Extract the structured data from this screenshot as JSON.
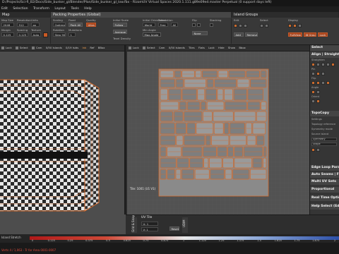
{
  "window": {
    "title": "D:/Projects/Sci-fi_B2/Docs/Side_bunker_gl/Blender/Plan/Side_bunker_gl_low.fbx - RizomUV Virtual Spaces 2020.1.111.g89e09ed.master Perpetual (0 support days left)"
  },
  "menu": [
    "Edit",
    "Selection",
    "Transform",
    "Layout",
    "Tools",
    "Help"
  ],
  "toolbar": {
    "map_head": "Map",
    "packing_head": "Packing Properties (Global)",
    "island_head": "Island Groups",
    "map": {
      "size_label": "Map Size",
      "size_value": "2048",
      "res_label": "Resolution",
      "res_value": "512",
      "margin_label": "Margin",
      "margin_value": "0.125",
      "space_label": "Spacing",
      "space_value": "0.125",
      "unit_label": "Units",
      "unit_value": "px",
      "tex_label": "Texture",
      "tex_value": "Auto"
    },
    "packing": {
      "scaling_label": "Scaling",
      "scaling_value": "Optimize",
      "fixed_label": "Fixed",
      "fixed_value": "Pack All",
      "rotation_label": "Rotation",
      "rotation_value": "Step 90",
      "mutations_label": "Mutations",
      "mutations_value": "1",
      "quality_label": "Quality",
      "quality_value": "Ultra",
      "follow_label": "Initial Scale",
      "follow_value": "Follow",
      "average_label": "Average",
      "texel_label": "Texel Density",
      "init_label": "Initial Orientation",
      "init_value": "World",
      "translation_label": "Translation",
      "translation_value": "Free",
      "min_angle_label": "Min Angle",
      "max_angle_label": "Max Angle",
      "optimize_label": "Optimize on",
      "optimize_value": "All",
      "flip_label": "Flip",
      "flip_value": "None",
      "stack_label": "Stacking"
    },
    "island": {
      "edit_label": "Edit",
      "select_label": "Select",
      "display_label": "Display",
      "add_label": "Add",
      "remove_label": "Remove",
      "fullview": "FullView",
      "ib": "IB Grou",
      "lock": "Lock"
    }
  },
  "viewport3d": {
    "tools": [
      "Lock",
      "Select",
      "Cam",
      "0/50 Islands",
      "0/19 Islds",
      "Ink",
      "Ref",
      "BBox",
      "1/1"
    ]
  },
  "viewport_uv": {
    "tools": [
      "Lock",
      "Select",
      "Cam",
      "0/50 Islands",
      "0/19 Islds",
      "Tiles",
      "Flats",
      "Lock",
      "Hide",
      "Show",
      "Bbox"
    ],
    "tile_info": "Tile: 1001 (U1 V1)"
  },
  "right_panel": {
    "select_head": "Select",
    "align_head": "Align | Straighten",
    "straighten_label": "Straighten",
    "pin_label": "Pin",
    "flip_label": "Flip",
    "angle_label": "Angle",
    "orient_label": "Orient",
    "topocopy_head": "TopoCopy",
    "settings_label": "Settings",
    "topo_ref": "Topology reference",
    "symmetry": "Symmetry mode",
    "source_label": "Source island",
    "sym_value": "Symmetry",
    "sym_value2": "Shape",
    "edge_loop": "Edge Loop Parameters",
    "auto_seams": "Auto Seams | Fun",
    "multi_uv": "Multi UV Sets",
    "proportional": "Proportional",
    "real_time": "Real Time Options",
    "help_select": "Help Select (Edge"
  },
  "bottom": {
    "grid_label": "Grid & Snap",
    "uv_tile_label": "UV Tile",
    "u_label": "U: 1",
    "v_label": "V: 1",
    "reset_label": "Reset",
    "ucdim_label": "UDIM"
  },
  "status": {
    "island_stretch": "Island Stretch",
    "ticks": [
      "0",
      "0.125",
      "0.25",
      "0.375",
      "0.5",
      "0.625",
      "0.75",
      "0.875",
      "1",
      "1.125",
      "1.25",
      "1.375",
      "1.5",
      "1.625",
      "1.75",
      "1.875",
      "2"
    ],
    "footer": "Verts 4 / 1,063 - Tr for Area 0001-0007"
  },
  "colors": {
    "accent": "#c85a24",
    "checker_dark": "#2a2a2a",
    "checker_light": "#e6e6e6",
    "uv_line": "#d66a2a"
  }
}
